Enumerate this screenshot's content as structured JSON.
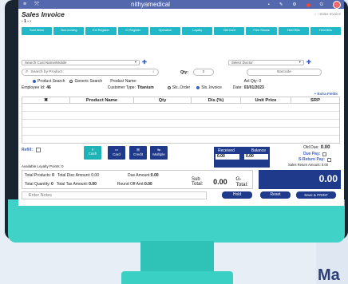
{
  "app": {
    "brand": "nithyamedical",
    "page_title": "Sales Invoice",
    "breadcrumb": "Sales Invoice",
    "pager": "- 1 -"
  },
  "tabs": [
    "Sold Items",
    "Non-moving",
    "Ext Register",
    "Cr Register",
    "Operation",
    "Loyalty",
    "Gift Card",
    "Free Stocks",
    "Held Bills",
    "Held Bills"
  ],
  "search": {
    "cust_placeholder": "Search Cust Name/Mobile",
    "product_placeholder": "Search by Product",
    "qty_label": "Qty:",
    "qty_value": "0",
    "barcode_placeholder": "Barcode",
    "doctor_placeholder": "Select Doctor"
  },
  "options": {
    "product_search": "Product Search",
    "generic_search": "Generic Search",
    "product_name_label": "Product Name:",
    "avl_qty": "Avl Qty: 0"
  },
  "meta": {
    "employee_id_label": "Employee Id:",
    "employee_id": "46",
    "customer_type_label": "Customer Type:",
    "customer_type": "Titanium",
    "sls_order": "Sls..Order",
    "sls_invoice": "Sls..Invoice",
    "date_label": "Date:",
    "date": "03/01/2023",
    "extra_fields": "+ Extra Fields"
  },
  "table": {
    "headers": [
      "✖",
      "Product Name",
      "Qty",
      "Dis (%)",
      "Unit Price",
      "SRP"
    ]
  },
  "payment": {
    "refill_label": "Refill:",
    "cash": "Cash",
    "card": "Card",
    "credit": "Credit",
    "multiple": "Multiple",
    "received_label": "Received",
    "balance_label": "Balance",
    "received": "0.00",
    "balance": "0.00",
    "old_due_label": "Old Due:",
    "old_due": "0.00",
    "due_pay": "Due Pay:",
    "sreturn_pay": "S-Return Pay:",
    "sales_return": "Sales Return Amount: 0.00",
    "loyalty": "Available Loyalty Points: 0"
  },
  "totals": {
    "products_label": "Total Products:",
    "products": "0",
    "disc_label": "Total Disc Amount:",
    "disc": "0.00",
    "due_label": "Due Amount:",
    "due": "0.00",
    "qty_label": "Total Quantity:",
    "qty": "0",
    "tax_label": "Total Tax Amount:",
    "tax": "0.00",
    "roundoff_label": "Round Off Amt:",
    "roundoff": "0.00",
    "subtotal_label": "Sub Total:",
    "subtotal": "0.00",
    "gtotal_label": "G-Total:",
    "gtotal": "0.00"
  },
  "footer": {
    "notes_placeholder": "Enter Notes",
    "hold": "Hold",
    "reset": "Reset",
    "save_print": "Save & PRINT"
  },
  "backdrop": {
    "text": "Ma"
  }
}
